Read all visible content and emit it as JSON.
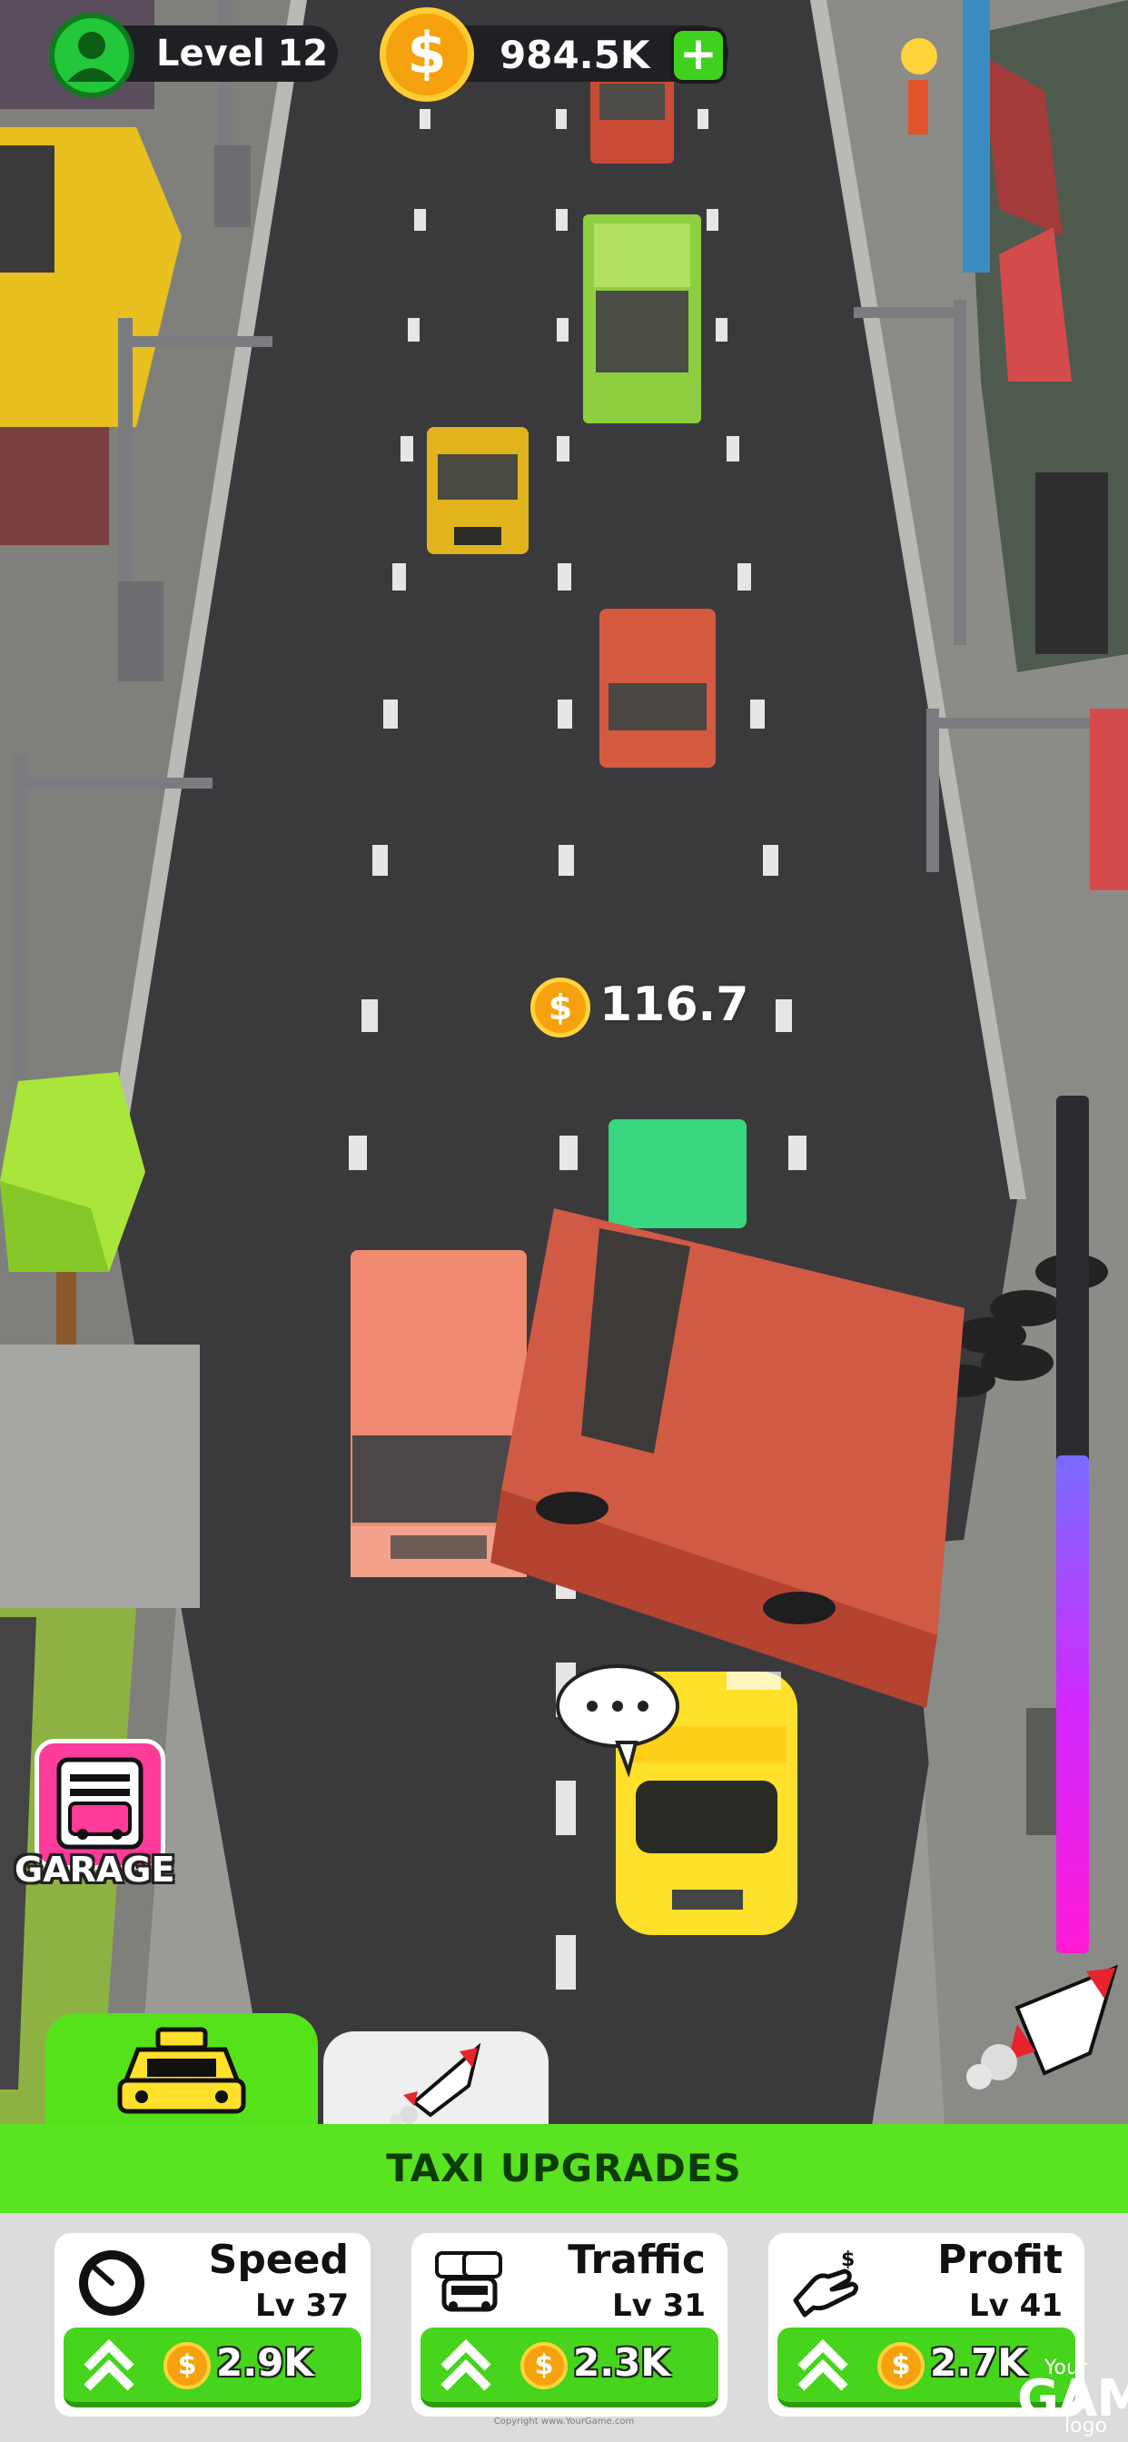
{
  "hud": {
    "level_label": "Level 12",
    "coin_balance": "984.5K",
    "coin_symbol": "$",
    "add_symbol": "+"
  },
  "scene": {
    "earned_coin_symbol": "$",
    "earned_amount": "116.7",
    "garage_label": "GARAGE",
    "trip_progress_fraction": 0.58
  },
  "upgrades": {
    "header": "TAXI UPGRADES",
    "tabs": [
      {
        "name": "taxi",
        "icon": "taxi-icon",
        "active": true
      },
      {
        "name": "rocket",
        "icon": "rocket-icon",
        "active": false
      }
    ],
    "cards": [
      {
        "title": "Speed",
        "level": "Lv 37",
        "price": "2.9K",
        "icon": "speedometer-icon"
      },
      {
        "title": "Traffic",
        "level": "Lv 31",
        "price": "2.3K",
        "icon": "traffic-cars-icon"
      },
      {
        "title": "Profit",
        "level": "Lv 41",
        "price": "2.7K",
        "icon": "hand-money-icon"
      }
    ],
    "coin_symbol": "$"
  },
  "watermark": {
    "line1": "Your",
    "line2": "GAME",
    "line3": "logo",
    "copyright": "Copyright www.YourGame.com"
  },
  "colors": {
    "road": "#3a3a3c",
    "accent_green": "#5ae321",
    "garage_pink": "#ff3c9a",
    "coin_gold": "#f6a20e",
    "taxi_yellow": "#ffe02a"
  }
}
